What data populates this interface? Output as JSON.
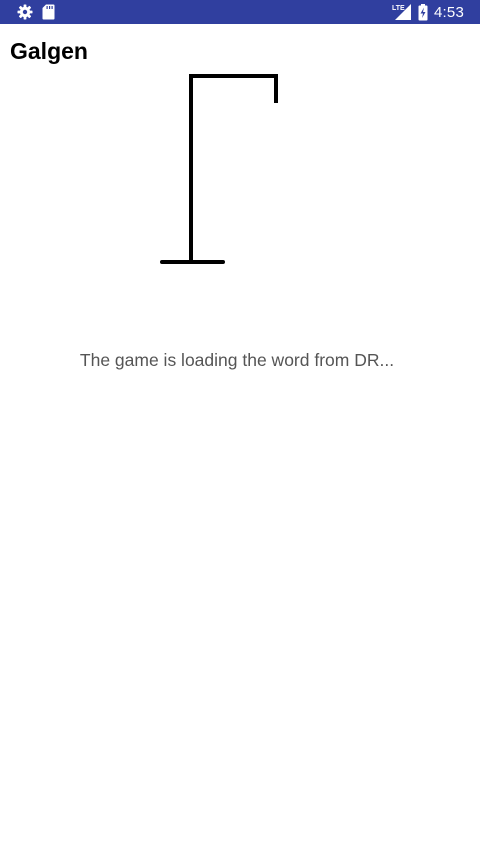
{
  "status_bar": {
    "time": "4:53",
    "network_label": "LTE",
    "left_icons": [
      "gear-icon",
      "sd-card-icon"
    ],
    "right_icons": [
      "signal-icon",
      "battery-charging-icon"
    ],
    "background": "#303f9f"
  },
  "app": {
    "title": "Galgen"
  },
  "game": {
    "status_message": "The game is loading the word from DR...",
    "stage_parts_shown": [
      "base",
      "pole",
      "top-beam",
      "rope"
    ]
  }
}
